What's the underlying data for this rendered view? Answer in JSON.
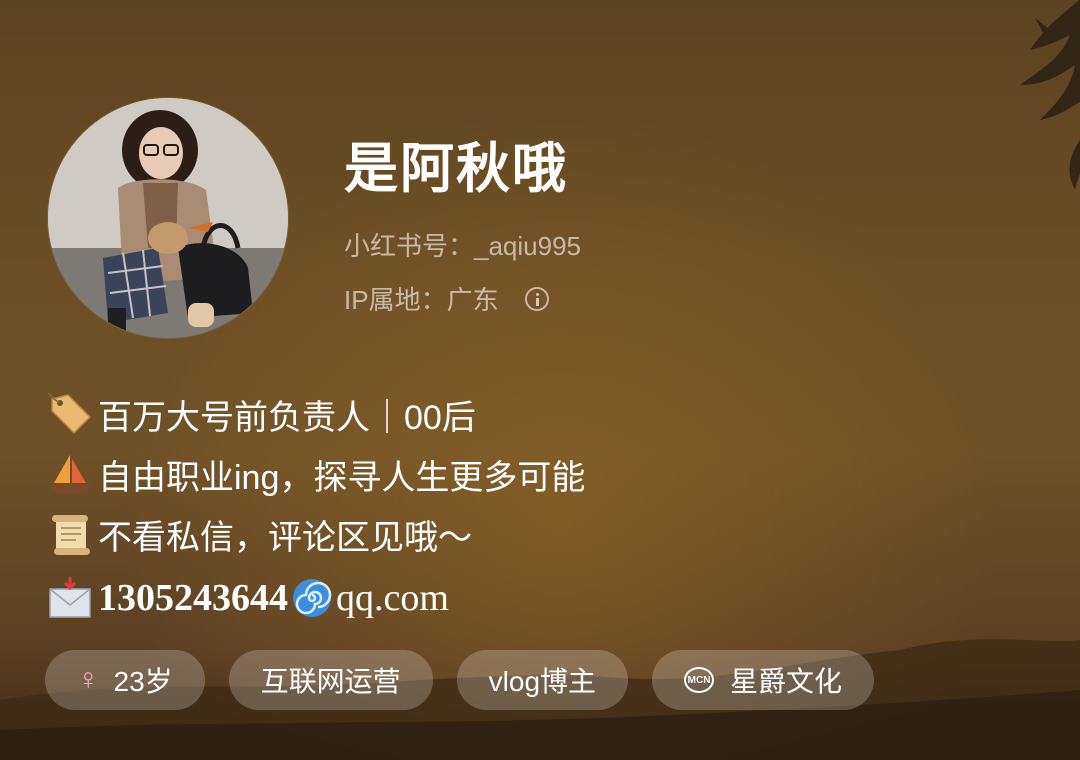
{
  "profile": {
    "nickname": "是阿秋哦",
    "id_line": "小红书号：_aqiu995",
    "ip_label": "IP属地：",
    "ip_value": "广东",
    "avatar_icon": "avatar-photo"
  },
  "bio": {
    "line1": {
      "icon": "label-tag-emoji",
      "text": "百万大号前负责人｜00后"
    },
    "line2": {
      "icon": "sailboat-emoji",
      "text": "自由职业ing，探寻人生更多可能"
    },
    "line3": {
      "icon": "scroll-emoji",
      "text": "不看私信，评论区见哦～"
    },
    "line4": {
      "icon": "envelope-emoji",
      "number": "1305243644",
      "separator_icon": "cyclone-emoji",
      "domain": "qq.com"
    }
  },
  "tags": {
    "gender_symbol": "♀",
    "age": "23岁",
    "job": "互联网运营",
    "role": "vlog博主",
    "mcn_badge": "MCN",
    "agency": "星爵文化"
  },
  "colors": {
    "background": "#6b4f25",
    "tag_background": "rgba(255,255,255,0.22)",
    "gender_pink": "#f7a9b8"
  }
}
